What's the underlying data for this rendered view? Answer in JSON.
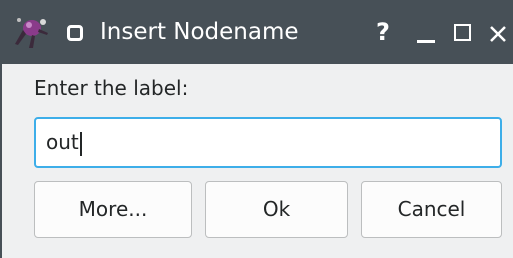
{
  "window": {
    "title": "Insert Nodename",
    "help_label": "?",
    "icons": [
      "app-logo-icon",
      "pin-icon",
      "minimize-icon",
      "maximize-icon",
      "close-icon"
    ]
  },
  "form": {
    "prompt": "Enter the label:",
    "input_value": "out"
  },
  "buttons": {
    "more": "More...",
    "ok": "Ok",
    "cancel": "Cancel"
  },
  "colors": {
    "titlebar": "#475057",
    "focus_border": "#3daee9",
    "dialog_bg": "#eff0f1"
  }
}
